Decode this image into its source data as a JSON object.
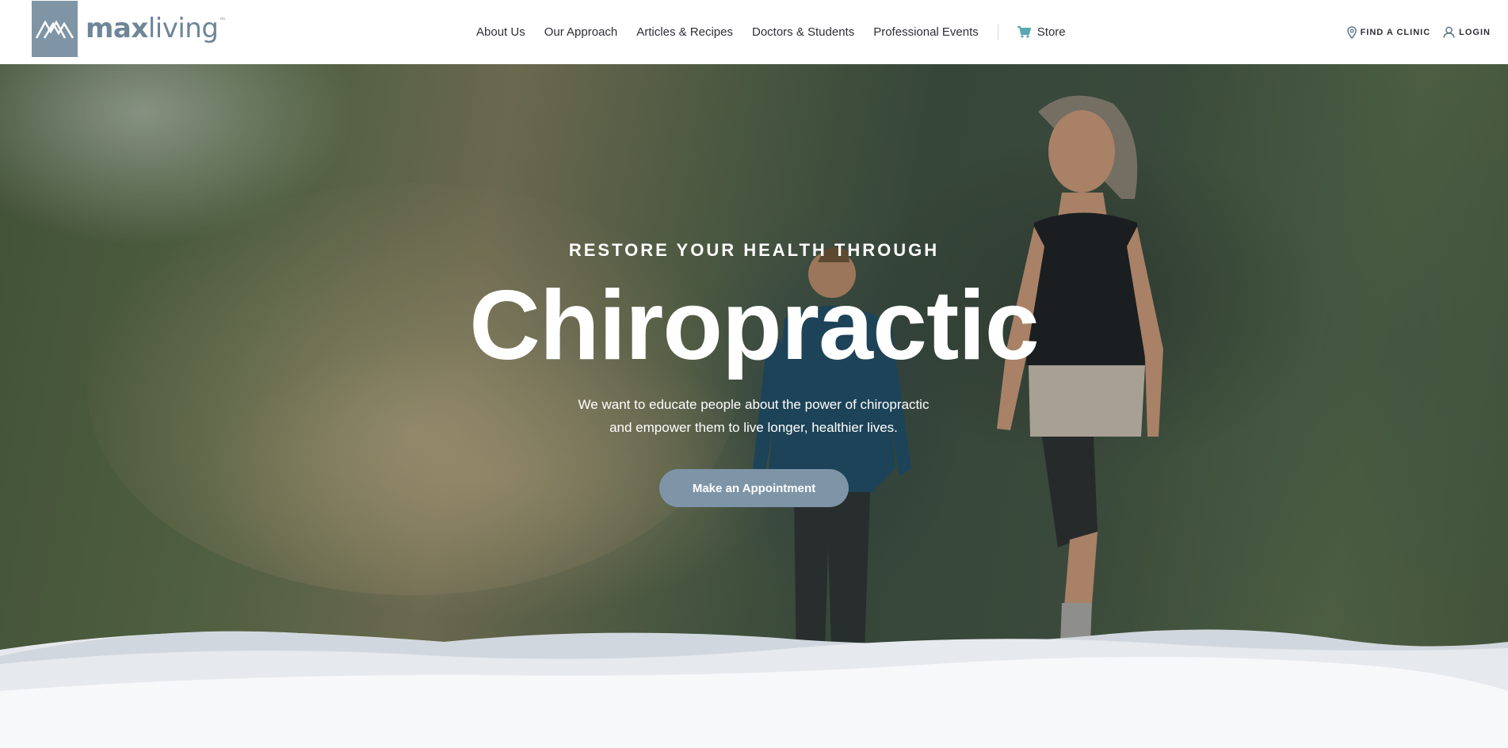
{
  "header": {
    "logo": {
      "text_bold": "max",
      "text_light": "living",
      "trademark": "™",
      "icon": "mountain-logo-icon"
    },
    "nav": [
      {
        "label": "About Us"
      },
      {
        "label": "Our Approach"
      },
      {
        "label": "Articles & Recipes"
      },
      {
        "label": "Doctors & Students"
      },
      {
        "label": "Professional Events"
      }
    ],
    "store": {
      "label": "Store",
      "icon": "cart-icon"
    },
    "utility": {
      "find_clinic": {
        "label": "FIND A CLINIC",
        "icon": "map-pin-icon"
      },
      "login": {
        "label": "LOGIN",
        "icon": "user-icon"
      }
    }
  },
  "hero": {
    "eyebrow": "RESTORE YOUR HEALTH THROUGH",
    "headline": "Chiropractic",
    "subtext_line1": "We want to educate people about the power of chiropractic",
    "subtext_line2": "and empower them to live longer, healthier lives.",
    "cta_label": "Make an Appointment"
  },
  "colors": {
    "brand": "#7f95a6",
    "cta": "#7e95a8",
    "store_icon": "#5aa8b0",
    "nav_text": "#2d2f36",
    "page_bg": "#f7f8fa"
  }
}
